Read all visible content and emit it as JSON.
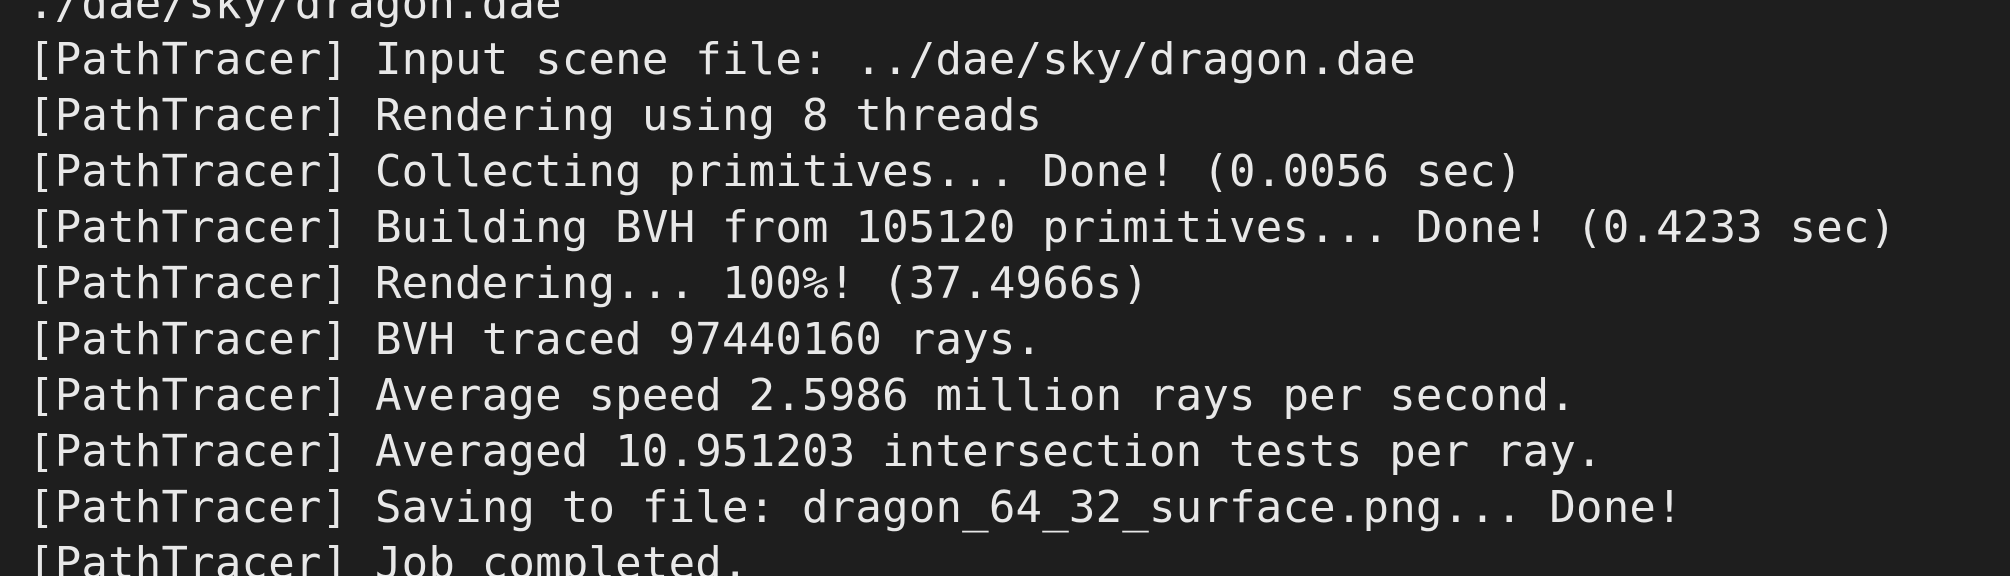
{
  "terminal": {
    "lines": [
      "./dae/sky/dragon.dae",
      "[PathTracer] Input scene file: ../dae/sky/dragon.dae",
      "[PathTracer] Rendering using 8 threads",
      "[PathTracer] Collecting primitives... Done! (0.0056 sec)",
      "[PathTracer] Building BVH from 105120 primitives... Done! (0.4233 sec)",
      "[PathTracer] Rendering... 100%! (37.4966s)",
      "[PathTracer] BVH traced 97440160 rays.",
      "[PathTracer] Average speed 2.5986 million rays per second.",
      "[PathTracer] Averaged 10.951203 intersection tests per ray.",
      "[PathTracer] Saving to file: dragon_64_32_surface.png... Done!",
      "[PathTracer] Job completed."
    ]
  },
  "colors": {
    "background": "#1e1e1e",
    "text": "#e8e8e8"
  }
}
